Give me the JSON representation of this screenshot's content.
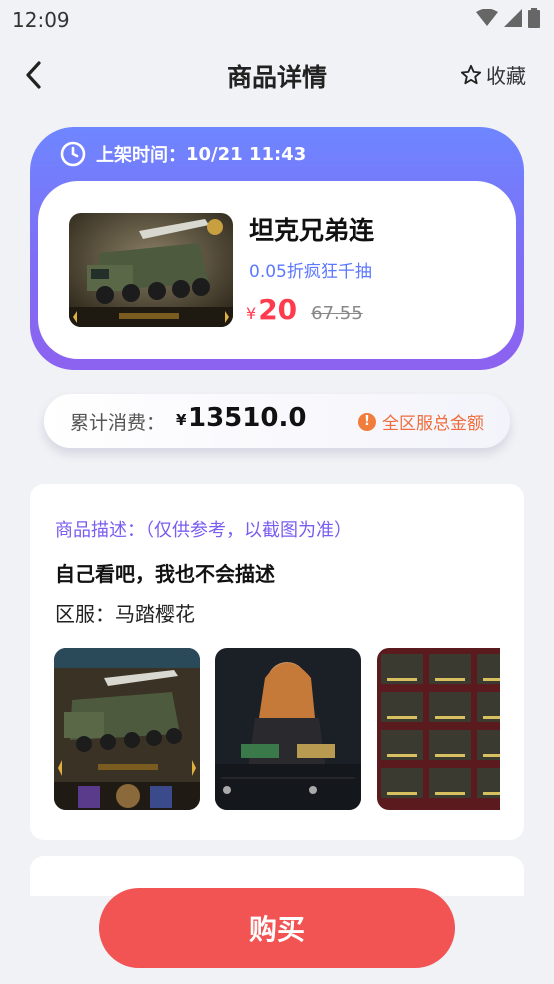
{
  "status": {
    "time": "12:09"
  },
  "header": {
    "title": "商品详情",
    "favorite_label": "收藏"
  },
  "product": {
    "listing_label": "上架时间：",
    "listing_time": "10/21 11:43",
    "name": "坦克兄弟连",
    "subtitle": "0.05折疯狂千抽",
    "currency_symbol": "¥",
    "price": "20",
    "original_price": "67.55"
  },
  "spend": {
    "label": "累计消费：",
    "currency_symbol": "¥",
    "value": "13510.0",
    "note": "全区服总金额"
  },
  "description": {
    "title": "商品描述：（仅供参考，以截图为准）",
    "text": "自己看吧，我也不会描述",
    "server": "区服：马踏樱花"
  },
  "buy_button": {
    "label": "购买"
  },
  "colors": {
    "accent": "#6e86ff",
    "price_red": "#ff3b4e",
    "buy_red": "#f25353"
  }
}
